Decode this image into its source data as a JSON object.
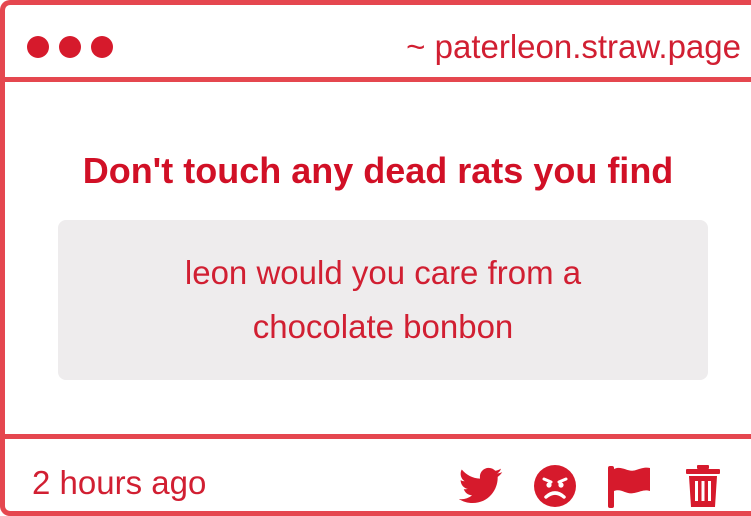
{
  "titlebar": {
    "url": "~ paterleon.straw.page"
  },
  "post": {
    "question": "Don't touch any dead rats you find",
    "message": "leon would you care from a chocolate bonbon"
  },
  "footer": {
    "timestamp": "2 hours ago",
    "actions": [
      "twitter-icon",
      "angry-face-icon",
      "flag-icon",
      "trash-icon"
    ]
  },
  "colors": {
    "accent": "#d11f32",
    "border": "#e5474f",
    "message_bg": "#eeeced"
  }
}
